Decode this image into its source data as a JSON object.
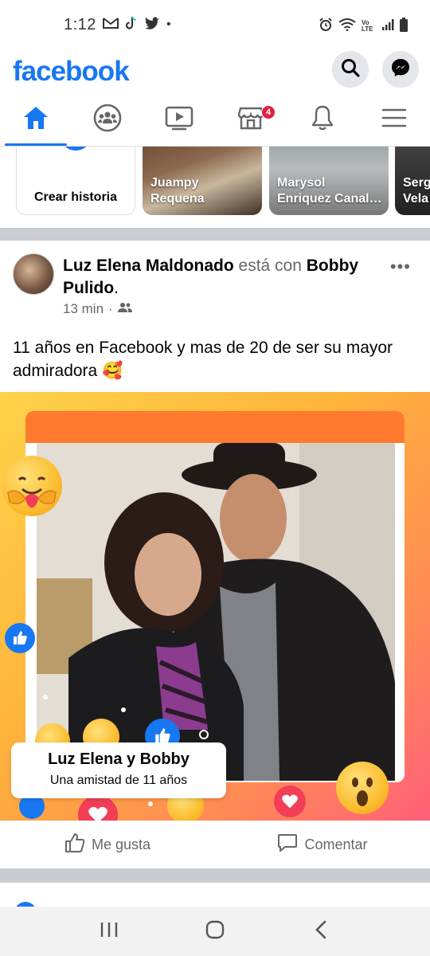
{
  "status_bar": {
    "time": "1:12",
    "left_icons": [
      "gmail-icon",
      "tiktok-icon",
      "twitter-icon",
      "dot-icon"
    ],
    "right_icons": [
      "alarm-icon",
      "wifi-icon",
      "volte-icon",
      "signal-icon",
      "battery-icon"
    ],
    "volte_text": "Vo LTE"
  },
  "header": {
    "logo": "facebook",
    "brand_color": "#1877f2"
  },
  "nav": {
    "tabs": [
      {
        "name": "home",
        "active": true
      },
      {
        "name": "groups",
        "active": false
      },
      {
        "name": "watch",
        "active": false
      },
      {
        "name": "marketplace",
        "active": false,
        "badge": "4"
      },
      {
        "name": "notifications",
        "active": false
      },
      {
        "name": "menu",
        "active": false
      }
    ]
  },
  "stories": [
    {
      "label": "Crear historia"
    },
    {
      "name": "Juampy\nRequena"
    },
    {
      "name": "Marysol\nEnriquez Canal…"
    },
    {
      "name": "Serg\nVela"
    }
  ],
  "post": {
    "author": "Luz Elena Maldonado",
    "with_text": "está con",
    "tagged": "Bobby Pulido",
    "period": ".",
    "time": "13 min",
    "separator": "·",
    "text": "11 años en Facebook y mas de 20 de ser su mayor admiradora 🥰",
    "card": {
      "title": "Luz Elena y Bobby",
      "subtitle": "Una amistad de 11 años"
    },
    "actions": {
      "like": "Me gusta",
      "comment": "Comentar"
    }
  }
}
